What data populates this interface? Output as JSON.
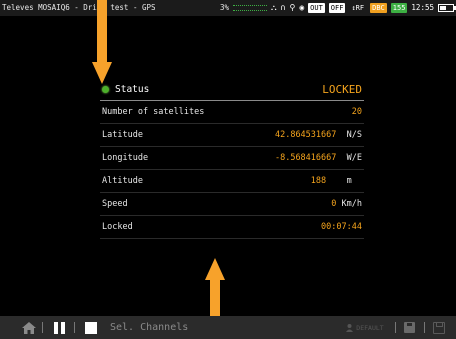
{
  "statusbar": {
    "title": "Televes MOSAIQ6 - Drive test - GPS",
    "battery_percent_text": "3%",
    "tags": {
      "out": "OUT",
      "off": "OFF",
      "rf": "↕RF",
      "dbc": "DBC",
      "num": "155"
    },
    "time": "12:55",
    "battery_level": 0.5,
    "icons": [
      "network-icon",
      "headphones-icon",
      "location-pin-icon",
      "wifi-icon"
    ]
  },
  "status": {
    "label": "Status",
    "value": "LOCKED"
  },
  "rows": [
    {
      "label": "Number of satellites",
      "value": "20",
      "unit": ""
    },
    {
      "label": "Latitude",
      "value": "42.864531667",
      "unit": "N/S"
    },
    {
      "label": "Longitude",
      "value": "-8.568416667",
      "unit": "W/E"
    },
    {
      "label": "Altitude",
      "value": "188",
      "unit": "m"
    },
    {
      "label": "Speed",
      "value": "0",
      "unit": "Km/h"
    },
    {
      "label": "Locked",
      "value": "00:07:44",
      "unit": ""
    }
  ],
  "bottombar": {
    "sel_channels": "Sel. Channels",
    "default": "DEFAULT"
  },
  "colors": {
    "accent": "#f5a41d",
    "arrow": "#f7a22b",
    "ok": "#4caf2a"
  }
}
